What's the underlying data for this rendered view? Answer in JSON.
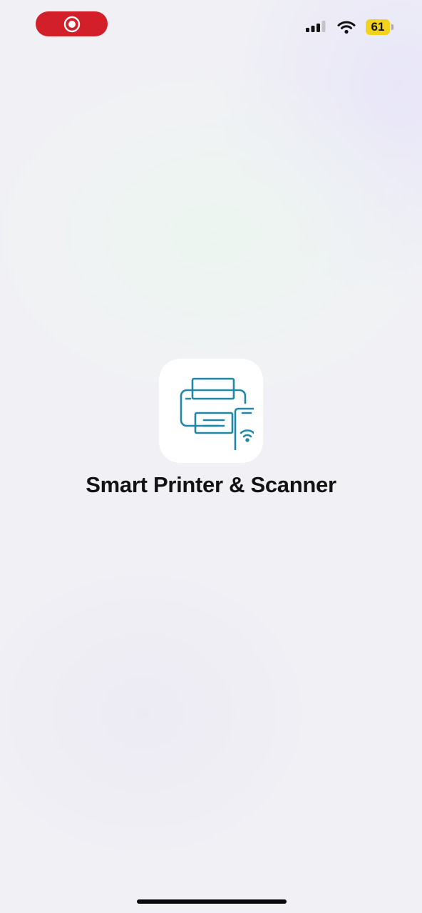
{
  "status_bar": {
    "battery_level": "61",
    "battery_color": "#f2d21b",
    "recording_color": "#d31f2a",
    "icons": [
      "screen-recording-icon",
      "cellular-signal-icon",
      "wifi-icon",
      "battery-icon"
    ]
  },
  "splash": {
    "app_name": "Smart Printer & Scanner",
    "icon": "printer-phone-wifi-icon",
    "icon_color": "#1f88a8"
  }
}
